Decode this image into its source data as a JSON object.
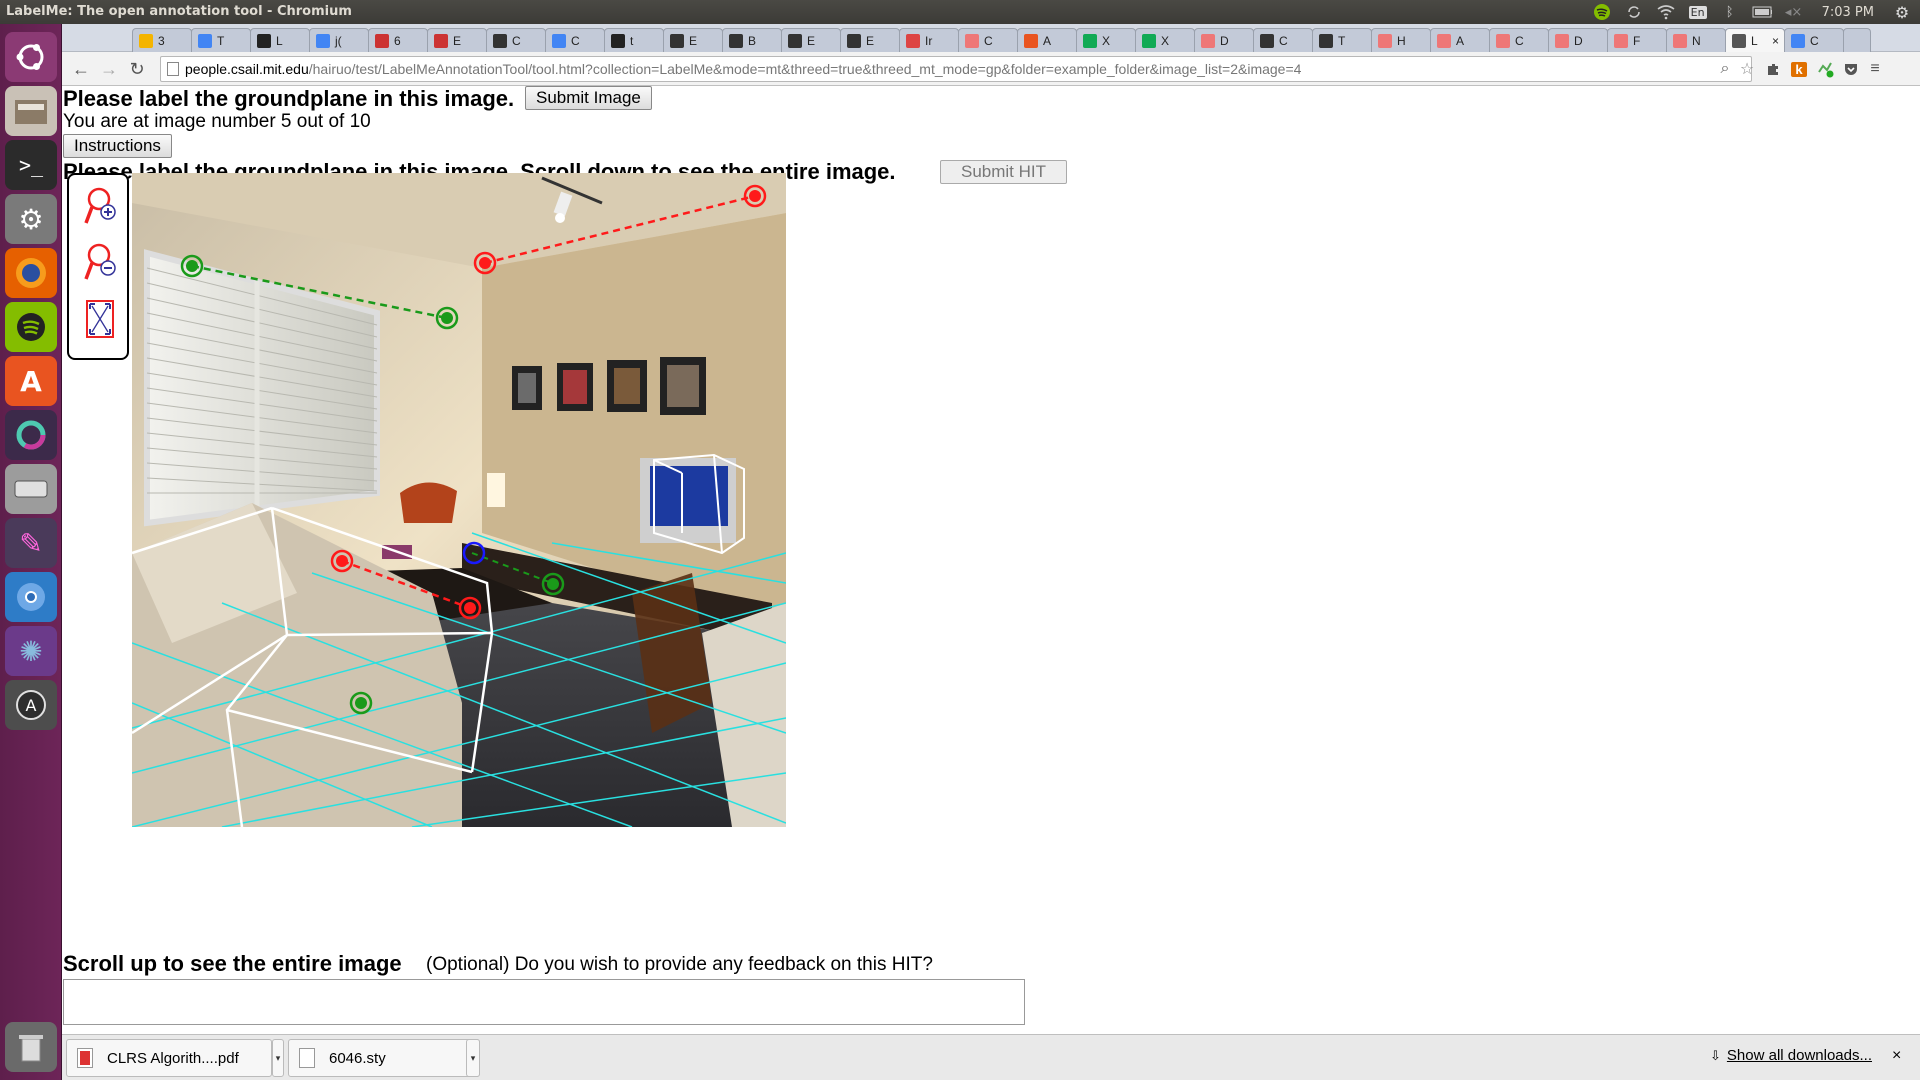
{
  "panel": {
    "window_title": "LabelMe: The open annotation tool - Chromium",
    "keyboard_layout": "En",
    "clock": "7:03 PM"
  },
  "launcher": {
    "items": [
      "ubuntu-dash",
      "files",
      "terminal",
      "system-settings",
      "firefox",
      "spotify",
      "software-center",
      "app-unity",
      "disk",
      "text-editor",
      "chromium",
      "shotwell",
      "software-updater",
      "trash"
    ]
  },
  "tabs": [
    {
      "label": "3",
      "icon": "drive",
      "color": "#f4b400"
    },
    {
      "label": "T",
      "icon": "docs",
      "color": "#4285f4"
    },
    {
      "label": "L",
      "icon": "github",
      "color": "#222"
    },
    {
      "label": "j(",
      "icon": "docs",
      "color": "#4285f4"
    },
    {
      "label": "6",
      "icon": "flag",
      "color": "#c33"
    },
    {
      "label": "E",
      "icon": "flag",
      "color": "#c33"
    },
    {
      "label": "C",
      "icon": "bee",
      "color": "#333"
    },
    {
      "label": "C",
      "icon": "docs",
      "color": "#4285f4"
    },
    {
      "label": "t",
      "icon": "github",
      "color": "#222"
    },
    {
      "label": "E",
      "icon": "wiki",
      "color": "#333"
    },
    {
      "label": "B",
      "icon": "wiki",
      "color": "#333"
    },
    {
      "label": "E",
      "icon": "wiki",
      "color": "#333"
    },
    {
      "label": "E",
      "icon": "wiki",
      "color": "#333"
    },
    {
      "label": "Ir",
      "icon": "gmail",
      "color": "#d44"
    },
    {
      "label": "C",
      "icon": "matlab",
      "color": "#e77"
    },
    {
      "label": "A",
      "icon": "ubuntu",
      "color": "#e95420"
    },
    {
      "label": "X",
      "icon": "w3",
      "color": "#1a5"
    },
    {
      "label": "X",
      "icon": "w3",
      "color": "#1a5"
    },
    {
      "label": "D",
      "icon": "matlab",
      "color": "#e77"
    },
    {
      "label": "C",
      "icon": "wikipedia",
      "color": "#333"
    },
    {
      "label": "T",
      "icon": "wikipedia",
      "color": "#333"
    },
    {
      "label": "H",
      "icon": "matlab",
      "color": "#e77"
    },
    {
      "label": "A",
      "icon": "matlab",
      "color": "#e77"
    },
    {
      "label": "C",
      "icon": "matlab",
      "color": "#e77"
    },
    {
      "label": "D",
      "icon": "matlab",
      "color": "#e77"
    },
    {
      "label": "F",
      "icon": "matlab",
      "color": "#e77"
    },
    {
      "label": "N",
      "icon": "matlab",
      "color": "#e77"
    },
    {
      "label": "L",
      "icon": "labelme",
      "color": "#555"
    },
    {
      "label": "C",
      "icon": "docs",
      "color": "#4285f4"
    }
  ],
  "active_tab_index": 27,
  "address": {
    "host": "people.csail.mit.edu",
    "path": "/hairuo/test/LabelMeAnnotationTool/tool.html?collection=LabelMe&mode=mt&threed=true&threed_mt_mode=gp&folder=example_folder&image_list=2&image=4"
  },
  "page": {
    "heading": "Please label the groundplane in this image.",
    "submit_image_label": "Submit Image",
    "progress_text": "You are at image number 5 out of 10",
    "instructions_label": "Instructions",
    "heading2": "Please label the groundplane in this image. Scroll down to see the entire image.",
    "submit_hit_label": "Submit HIT",
    "zoom_tools": [
      "zoom-in",
      "zoom-out",
      "fit-image"
    ],
    "scroll_up_text": "Scroll up to see the entire image",
    "feedback_prompt": "(Optional) Do you wish to provide any feedback on this HIT?",
    "feedback_value": ""
  },
  "colors": {
    "control_point_red": "#ff1a1a",
    "control_point_green": "#1a9a1a",
    "control_point_blue": "#1a1aff",
    "grid_cyan": "#29e0e0"
  },
  "downloads": [
    {
      "name": "CLRS Algorith....pdf",
      "icon": "pdf"
    },
    {
      "name": "6046.sty",
      "icon": "file"
    }
  ],
  "show_all_downloads": "Show all downloads..."
}
